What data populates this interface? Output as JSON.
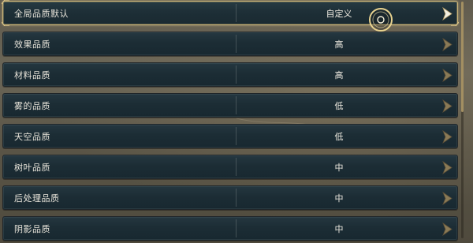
{
  "settings": [
    {
      "label": "全局品质默认",
      "value": "自定义",
      "selected": true
    },
    {
      "label": "效果品质",
      "value": "高",
      "selected": false
    },
    {
      "label": "材料品质",
      "value": "高",
      "selected": false
    },
    {
      "label": "雾的品质",
      "value": "低",
      "selected": false
    },
    {
      "label": "天空品质",
      "value": "低",
      "selected": false
    },
    {
      "label": "树叶品质",
      "value": "中",
      "selected": false
    },
    {
      "label": "后处理品质",
      "value": "中",
      "selected": false
    },
    {
      "label": "阴影品质",
      "value": "中",
      "selected": false
    }
  ],
  "icons": {
    "next": "chevron-right-icon",
    "cursor": "cursor-ring-icon"
  },
  "colors": {
    "accent_gold": "#c9b276",
    "row_bg": "#1c2d35",
    "text": "#e8e4da"
  }
}
